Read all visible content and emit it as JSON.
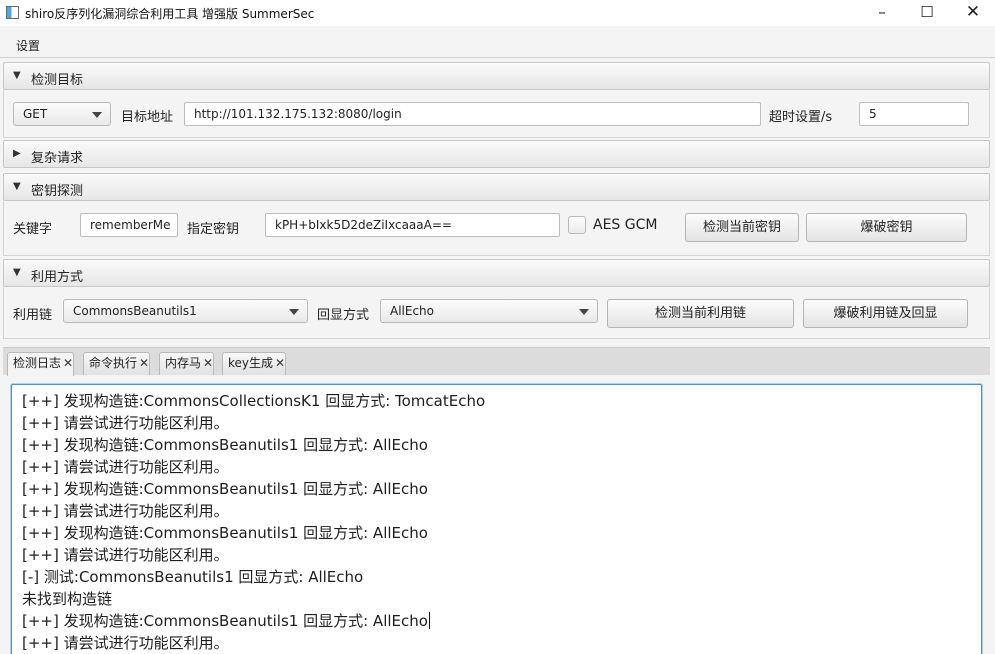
{
  "window": {
    "title": "shiro反序列化漏洞综合利用工具 增强版 SummerSec",
    "minimize_icon": "minimize-icon",
    "maximize_icon": "maximize-icon",
    "close_icon": "close-icon"
  },
  "menu": {
    "settings_label": "设置"
  },
  "target_section": {
    "title": "检测目标",
    "method": "GET",
    "url_label": "目标地址",
    "url_value": "http://101.132.175.132:8080/login",
    "timeout_label": "超时设置/s",
    "timeout_value": "5"
  },
  "complex_section": {
    "title": "复杂请求"
  },
  "key_section": {
    "title": "密钥探测",
    "keyword_label": "关键字",
    "keyword_value": "rememberMe",
    "key_label": "指定密钥",
    "key_value": "kPH+bIxk5D2deZiIxcaaaA==",
    "aes_gcm_label": "AES GCM",
    "aes_gcm_checked": false,
    "check_key_button": "检测当前密钥",
    "brute_key_button": "爆破密钥"
  },
  "exploit_section": {
    "title": "利用方式",
    "chain_label": "利用链",
    "chain_value": "CommonsBeanutils1",
    "echo_label": "回显方式",
    "echo_value": "AllEcho",
    "check_chain_button": "检测当前利用链",
    "brute_chain_button": "爆破利用链及回显"
  },
  "tabs": [
    {
      "label": "检测日志",
      "active": true
    },
    {
      "label": "命令执行",
      "active": false
    },
    {
      "label": "内存马",
      "active": false
    },
    {
      "label": "key生成",
      "active": false
    }
  ],
  "tab_close_glyph": "✕",
  "log_lines": [
    "[++] 发现构造链:CommonsCollectionsK1  回显方式: TomcatEcho",
    "[++] 请尝试进行功能区利用。",
    "[++] 发现构造链:CommonsBeanutils1  回显方式: AllEcho",
    "[++] 请尝试进行功能区利用。",
    "[++] 发现构造链:CommonsBeanutils1  回显方式: AllEcho",
    "[++] 请尝试进行功能区利用。",
    "[++] 发现构造链:CommonsBeanutils1  回显方式: AllEcho",
    "[++] 请尝试进行功能区利用。",
    "[-] 测试:CommonsBeanutils1  回显方式: AllEcho",
    "未找到构造链",
    "[++] 发现构造链:CommonsBeanutils1  回显方式: AllEcho",
    "[++] 请尝试进行功能区利用。"
  ],
  "colors": {
    "accent": "#3c98d8",
    "header": "#e6e6e6",
    "background": "#f4f4f4"
  }
}
